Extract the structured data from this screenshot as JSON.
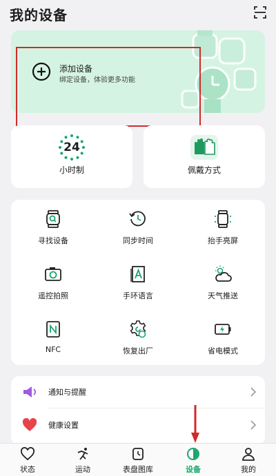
{
  "header": {
    "title": "我的设备",
    "scan_icon": "scan-icon"
  },
  "add_device": {
    "title": "添加设备",
    "subtitle": "绑定设备，体验更多功能",
    "icon": "plus-circle-icon",
    "background": "#d5f3e3"
  },
  "quick_cards": [
    {
      "label": "小时制",
      "icon": "clock-24-icon",
      "value": "24"
    },
    {
      "label": "佩戴方式",
      "icon": "hands-icon"
    }
  ],
  "features": [
    {
      "label": "寻找设备",
      "icon": "watch-search-icon"
    },
    {
      "label": "同步时间",
      "icon": "clock-sync-icon"
    },
    {
      "label": "抬手亮屏",
      "icon": "watch-raise-icon"
    },
    {
      "label": "遥控拍照",
      "icon": "camera-icon"
    },
    {
      "label": "手环语言",
      "icon": "language-icon"
    },
    {
      "label": "天气推送",
      "icon": "weather-icon"
    },
    {
      "label": "NFC",
      "icon": "nfc-icon"
    },
    {
      "label": "恢复出厂",
      "icon": "gear-reset-icon"
    },
    {
      "label": "省电模式",
      "icon": "battery-saver-icon"
    }
  ],
  "settings": [
    {
      "label": "通知与提醒",
      "icon": "speaker-icon",
      "color": "#a05be0"
    },
    {
      "label": "健康设置",
      "icon": "heart-icon",
      "color": "#e8424a"
    }
  ],
  "tabs": [
    {
      "label": "状态",
      "icon": "heart-outline-icon",
      "active": false
    },
    {
      "label": "运动",
      "icon": "run-icon",
      "active": false
    },
    {
      "label": "表盘图库",
      "icon": "watchface-icon",
      "active": false
    },
    {
      "label": "设备",
      "icon": "device-icon",
      "active": true
    },
    {
      "label": "我的",
      "icon": "person-icon",
      "active": false
    }
  ],
  "colors": {
    "accent": "#1aa66c",
    "highlight_box": "#d02a2a",
    "annotation_arrow": "#d02a2a"
  }
}
